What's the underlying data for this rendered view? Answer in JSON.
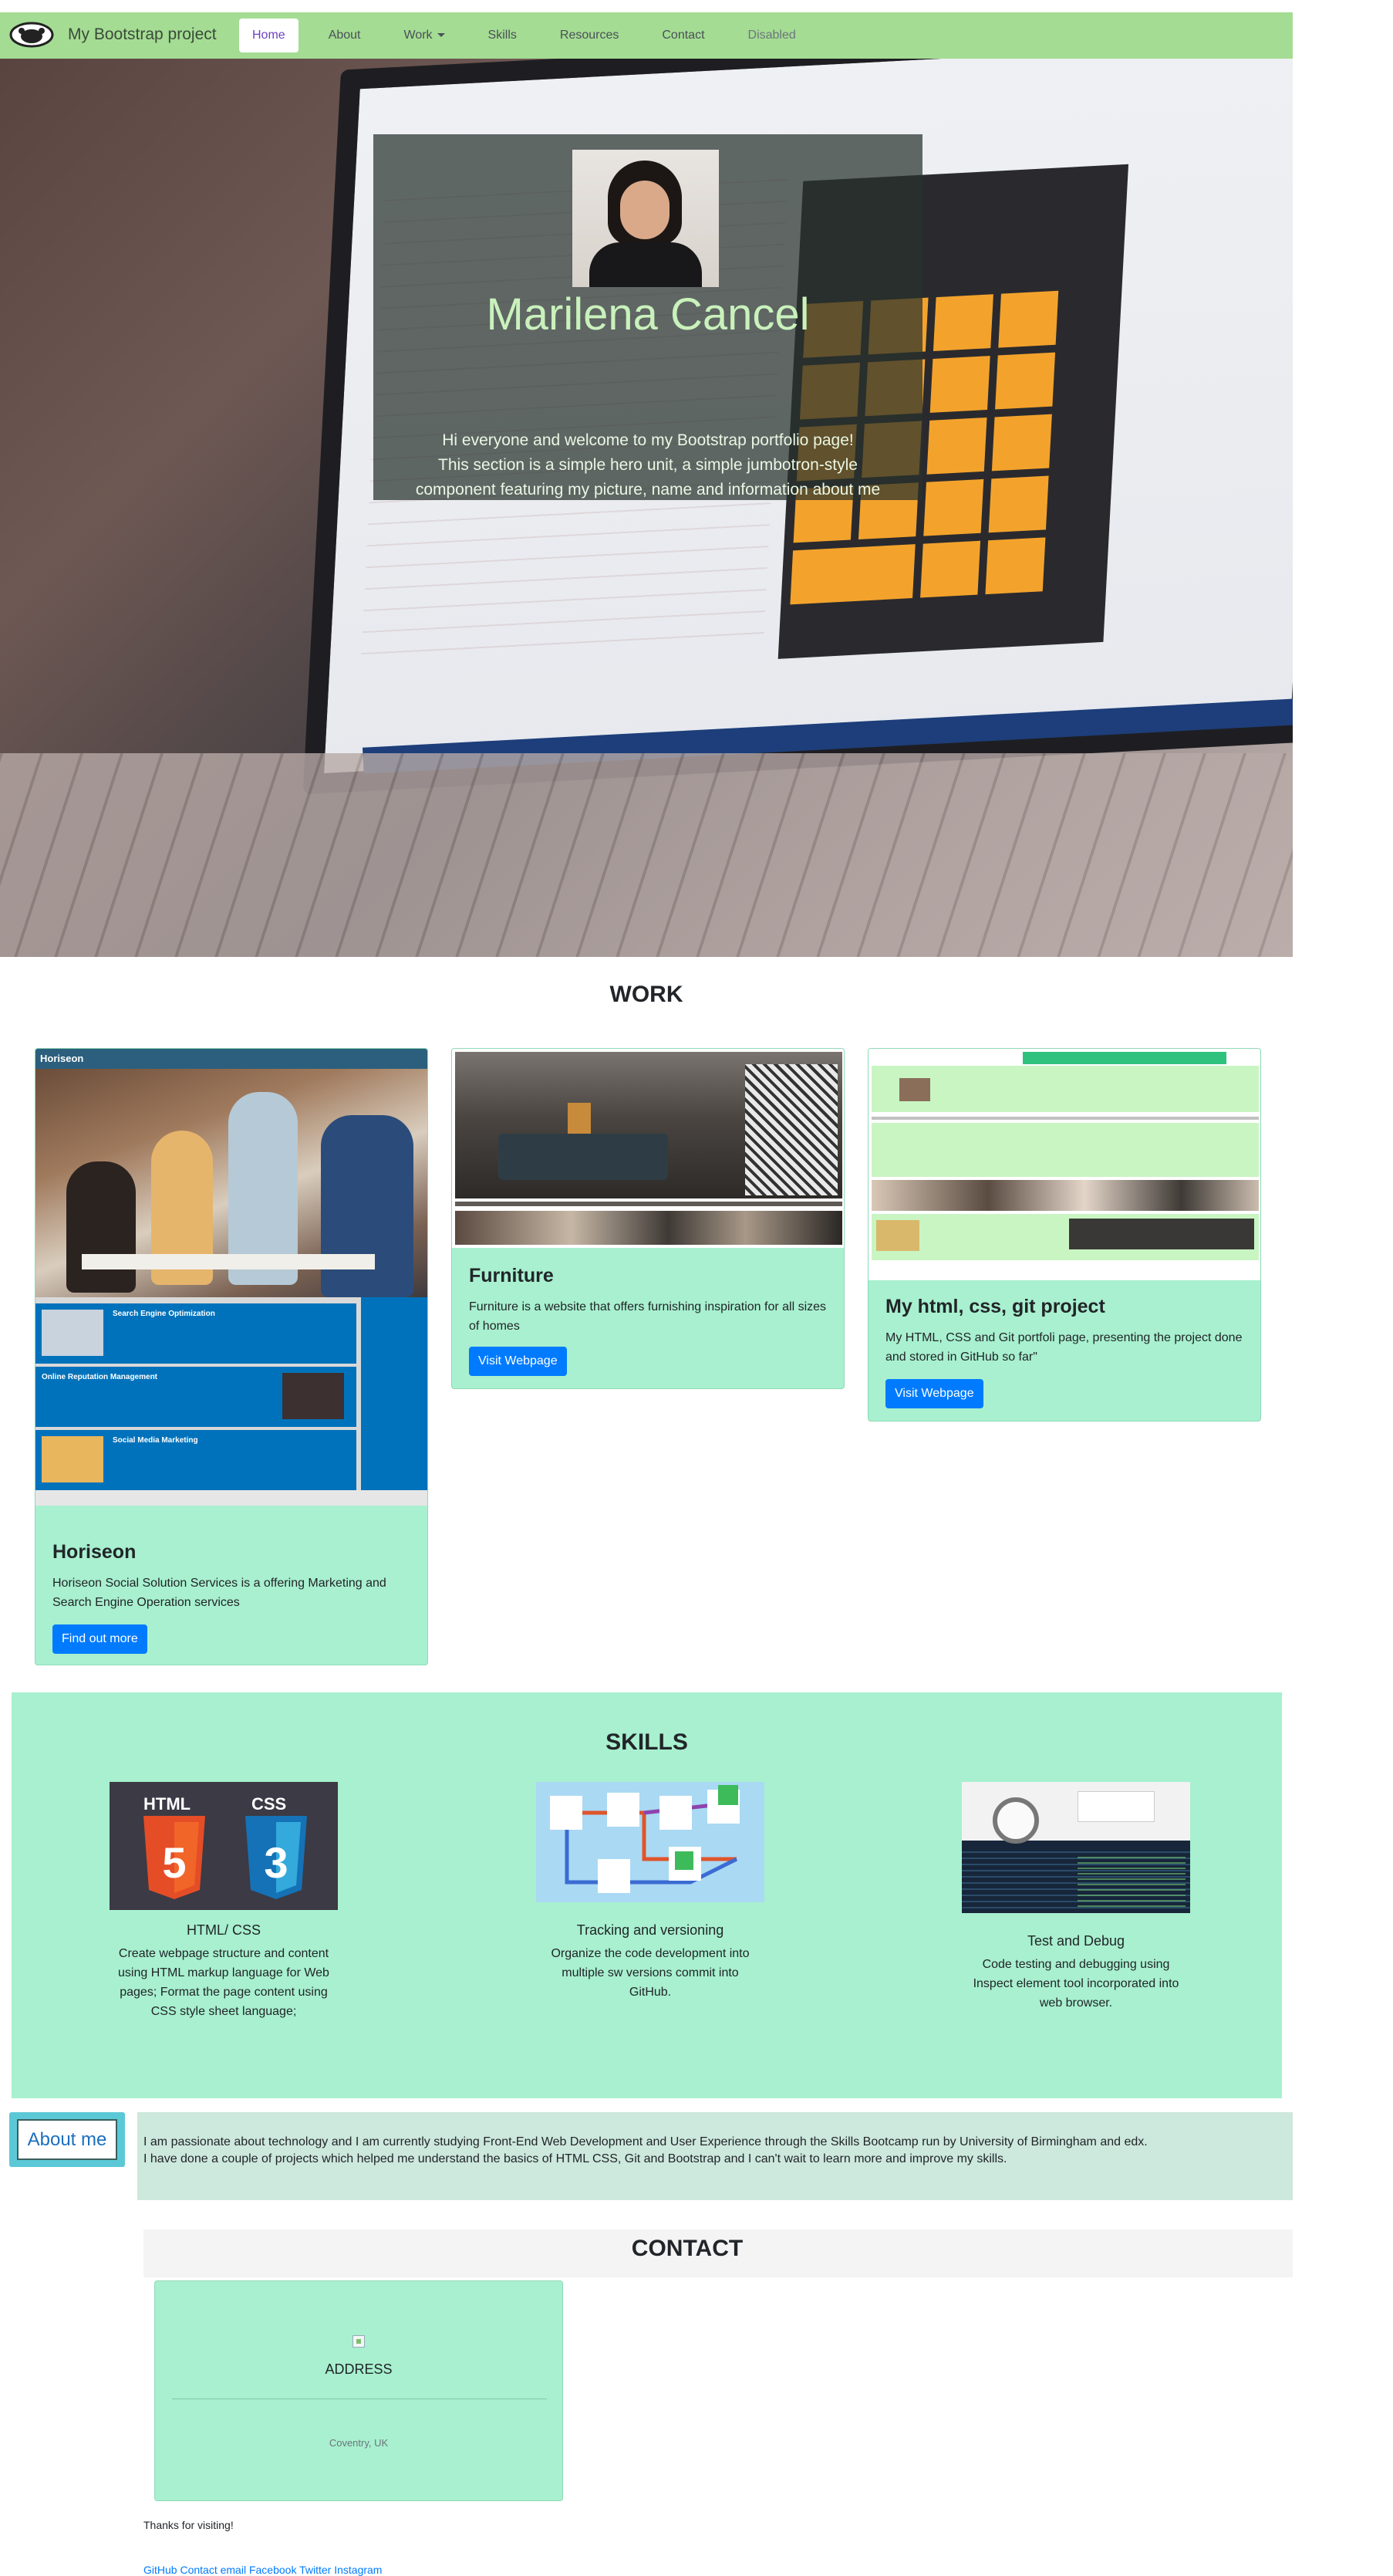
{
  "navbar": {
    "brand": "My Bootstrap project",
    "items": [
      {
        "label": "Home",
        "state": "active"
      },
      {
        "label": "About",
        "state": "normal"
      },
      {
        "label": "Work",
        "state": "dropdown"
      },
      {
        "label": "Skills",
        "state": "normal"
      },
      {
        "label": "Resources",
        "state": "normal"
      },
      {
        "label": "Contact",
        "state": "normal"
      },
      {
        "label": "Disabled",
        "state": "disabled"
      }
    ]
  },
  "hero": {
    "name": "Marilena Cancel",
    "intro_line1": "Hi everyone and welcome to my Bootstrap portfolio page!",
    "intro_line2": "This section is a simple hero unit, a simple jumbotron-style",
    "intro_line3": "component featuring my picture, name and information about me"
  },
  "work": {
    "heading": "WORK",
    "cards": [
      {
        "title": "Horiseon",
        "text": "Horiseon Social Solution Services is a offering Marketing and Search Engine Operation services",
        "button": "Find out more",
        "preview": {
          "header": "Horiseon",
          "blocks": [
            "Search Engine Optimization",
            "Online Reputation Management",
            "Social Media Marketing"
          ]
        }
      },
      {
        "title": "Furniture",
        "text": "Furniture is a website that offers furnishing inspiration for all sizes of homes",
        "button": "Visit Webpage"
      },
      {
        "title": "My html, css, git project",
        "text": "My HTML, CSS and Git portfoli page, presenting the project done and stored in GitHub so far\"",
        "button": "Visit Webpage"
      }
    ]
  },
  "skills": {
    "heading": "SKILLS",
    "items": [
      {
        "title": "HTML/ CSS",
        "text": "Create webpage structure and content using HTML markup language for Web pages; Format the page content using CSS style sheet language;",
        "logos": [
          "HTML",
          "CSS"
        ]
      },
      {
        "title": "Tracking and versioning",
        "text": "Organize the code development into multiple sw versions commit into GitHub."
      },
      {
        "title": "Test and Debug",
        "text": "Code testing and debugging using Inspect element tool incorporated into web browser."
      }
    ]
  },
  "about": {
    "button": "About me",
    "line1": "I am passionate about technology and I am currently studying Front-End Web Development and User Experience through the Skills Bootcamp run by University of Birmingham and edx.",
    "line2": "I have done a couple of projects which helped me understand the basics of HTML CSS, Git and Bootstrap and I can't wait to learn more and improve my skills."
  },
  "contact": {
    "heading": "CONTACT",
    "address_title": "ADDRESS",
    "address_value": "Coventry, UK"
  },
  "footer": {
    "thanks": "Thanks for visiting!",
    "links": [
      "GitHub",
      "Contact",
      "email",
      "Facebook",
      "Twitter",
      "Instagram"
    ]
  },
  "colors": {
    "navbar_bg": "#a4dc93",
    "card_bg": "#a8f0cf",
    "button_primary": "#007bff",
    "about_box_bg": "#cde8dd"
  }
}
